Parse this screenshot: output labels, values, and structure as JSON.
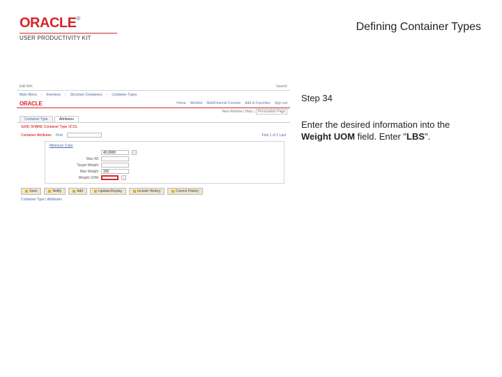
{
  "logo": {
    "brand": "ORACLE",
    "reg": "®",
    "sub": "USER PRODUCTIVITY KIT"
  },
  "page_title": "Defining Container Types",
  "instruction": {
    "step": "Step 34",
    "pre": "Enter the desired information into the ",
    "bold1": "Weight UOM",
    "mid": " field. Enter \"",
    "bold2": "LBS",
    "post": "\"."
  },
  "shot": {
    "win_left": "Edit Win",
    "win_right": "Search",
    "crumb1": "Main Menu",
    "crumb2": "Inventory",
    "crumb3": "Structure Containers",
    "crumb4": "Container Types",
    "nav_links": [
      "Home",
      "Worklist",
      "MultiChannel Console",
      "Add to Favorites",
      "Sign out"
    ],
    "oracle": "ORACLE",
    "sub_right1": "New Window | Help |",
    "sub_right2": "Personalize Page",
    "tab1": "Container Type",
    "tab2": "Attributes",
    "entity": "SetID  SHARE     Container Type  XCOL",
    "attr_label": "Container Attributes",
    "attr_find": "Find",
    "attr_count": "First  1 of 1  Last",
    "fields": {
      "min_cube_label": "Minimum Cube",
      "min_cube_val": "40.0000",
      "max_wt_label": "Max Wt",
      "target_wt_label": "Target Weight",
      "max_wt2_label": "Max Weight",
      "max_wt2_val": "150",
      "wt_uom_label": "Weight UOM",
      "wt_uom_val": ""
    },
    "buttons": [
      "Save",
      "Notify",
      "Add",
      "Update/Display",
      "Include History",
      "Correct History"
    ],
    "link": "Container Type | Attributes"
  }
}
